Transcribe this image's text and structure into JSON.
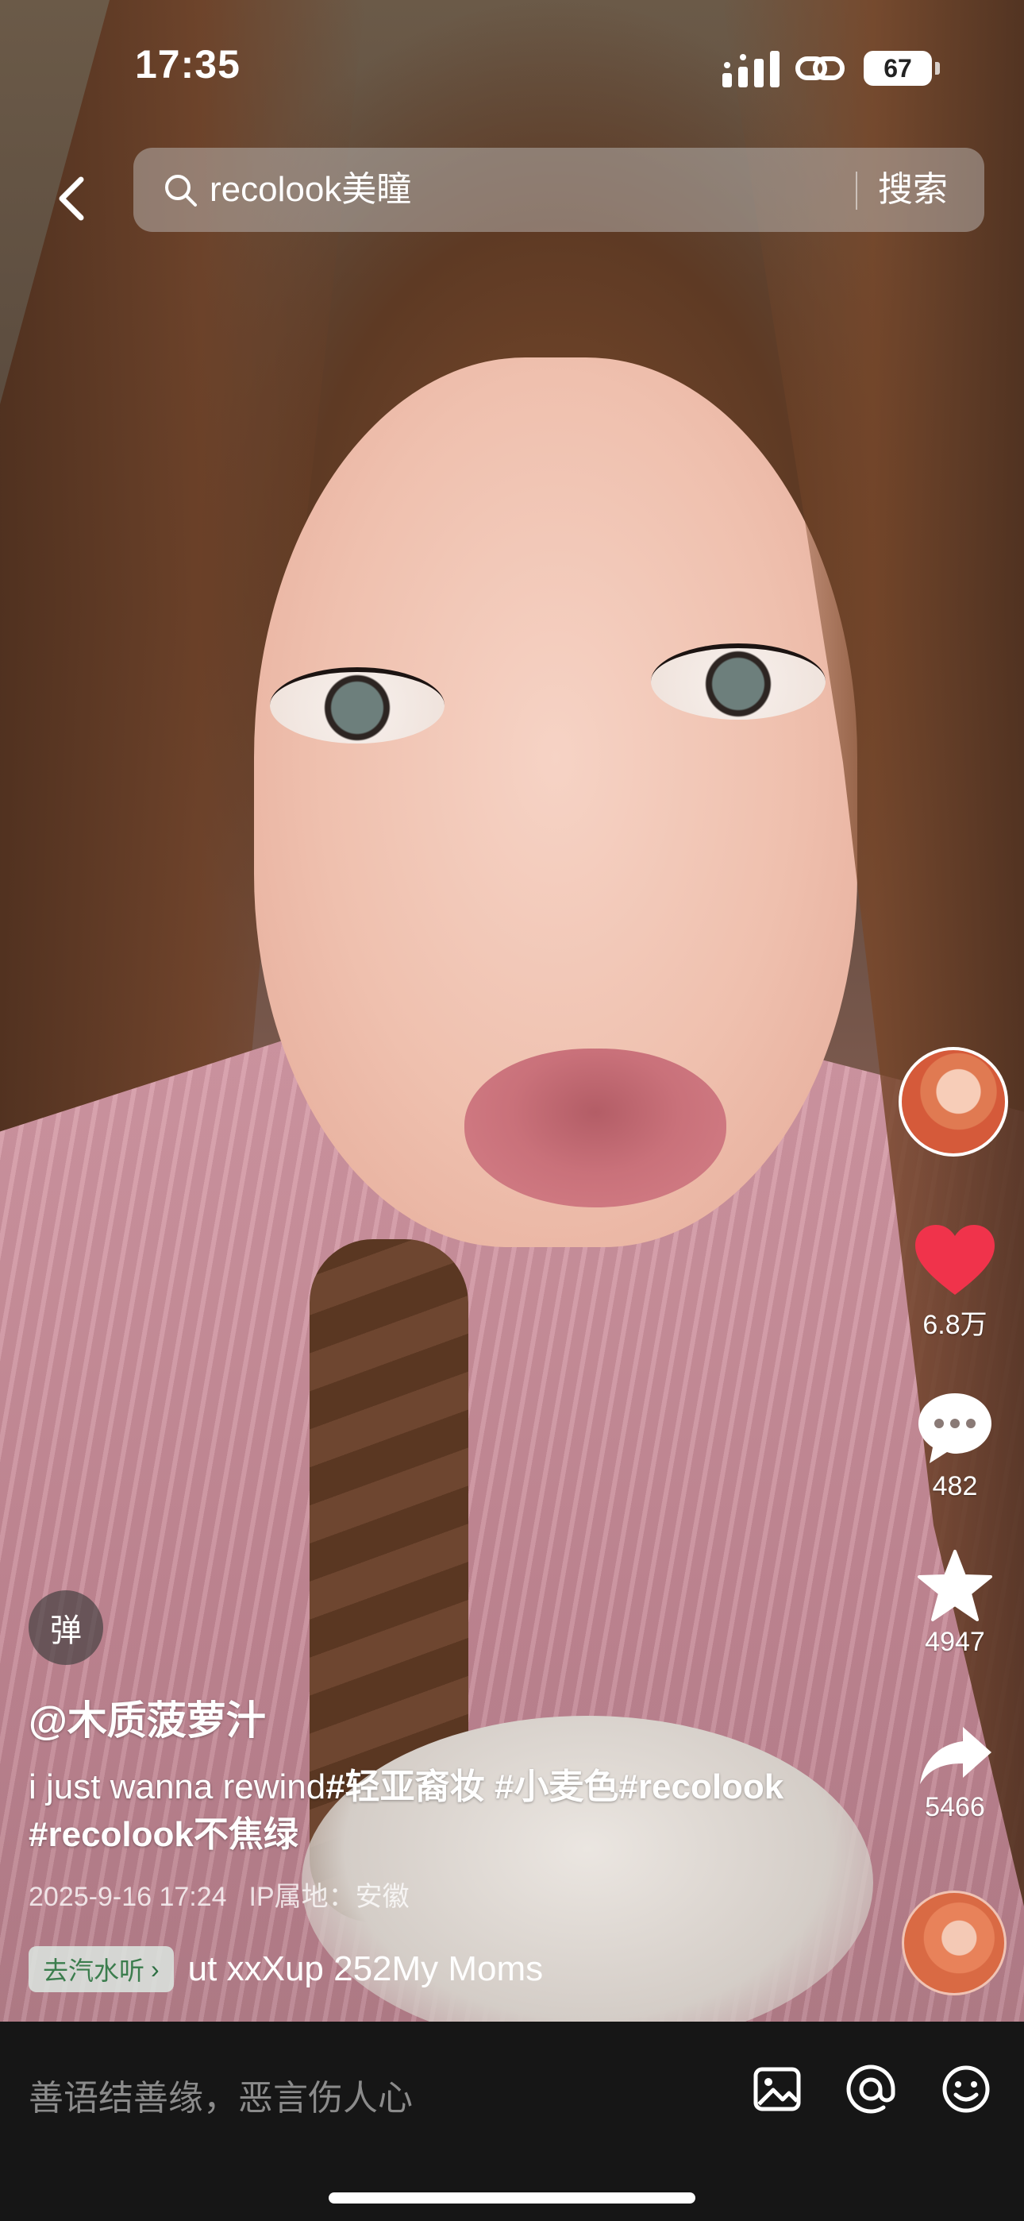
{
  "status": {
    "time": "17:35",
    "battery": "67"
  },
  "search": {
    "query": "recolook美瞳",
    "button_label": "搜索"
  },
  "danmaku": {
    "label": "弹"
  },
  "author": {
    "handle": "@木质菠萝汁"
  },
  "description": {
    "text": "i just wanna rewind",
    "tags": [
      "#轻亚裔妆",
      "#小麦色",
      "#recolook",
      "#recolook不焦绿"
    ]
  },
  "meta": {
    "date": "2025-9-16 17:24",
    "ip": "IP属地：安徽"
  },
  "music": {
    "chip_label": "去汽水听",
    "scroll_text": "ut xxXup 252My Moms"
  },
  "actions": {
    "likes": "6.8万",
    "comments": "482",
    "favorites": "4947",
    "shares": "5466"
  },
  "comment_bar": {
    "placeholder": "善语结善缘，恶言伤人心"
  },
  "colors": {
    "like": "#f0334b",
    "music_chip_text": "#3b7d4d"
  },
  "icons": [
    "back-icon",
    "search-icon",
    "heart-icon",
    "comment-icon",
    "star-icon",
    "share-icon",
    "image-icon",
    "at-icon",
    "emoji-icon"
  ]
}
